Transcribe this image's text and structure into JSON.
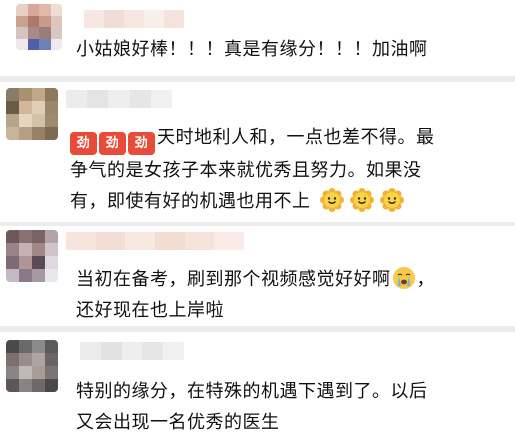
{
  "comments": [
    {
      "text": "小姑娘好棒！！！真是有缘分！！！加油啊"
    },
    {
      "reaction_badges": [
        "劲",
        "劲",
        "劲"
      ],
      "text_line1": "天时地利人和，一点也差不得。最",
      "text_line2": "争气的是女孩子本来就优秀且努力。如果没",
      "text_line3": "有，即使有好的机遇也用不上",
      "emojis": [
        "smile-flower-icon",
        "smile-flower-icon",
        "smile-flower-icon"
      ]
    },
    {
      "text_line1": "当初在备考，刷到那个视频感觉好好啊",
      "text_line1_end": "，",
      "emoji": "crying-face-icon",
      "text_line2": "还好现在也上岸啦"
    },
    {
      "text_line1": "特别的缘分，在特殊的机遇下遇到了。以后",
      "text_line2": "又会出现一名优秀的医生"
    }
  ],
  "colors": {
    "background": "#ececec",
    "card": "#ffffff",
    "badge": "#e94b3a",
    "emoji_face": "#f7c948"
  }
}
